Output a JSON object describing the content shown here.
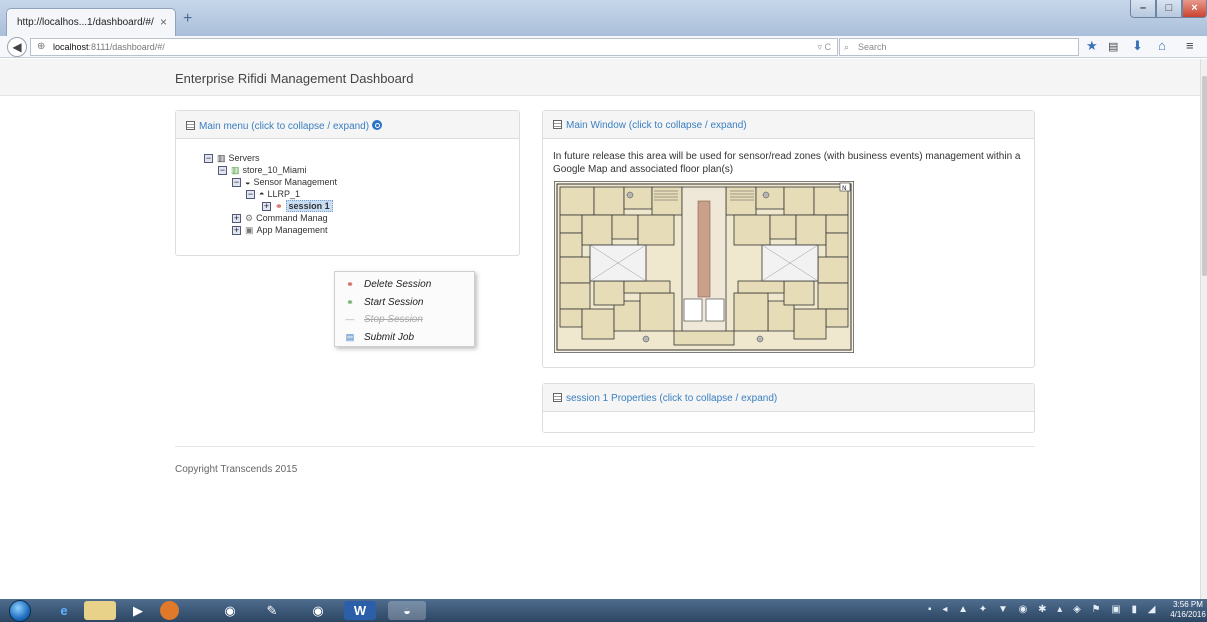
{
  "browser": {
    "tab_title": "http://localhos...1/dashboard/#/",
    "tab_close": "×",
    "new_tab": "+",
    "url_host": "localhost",
    "url_rest": ":8111/dashboard/#/",
    "url_tools": "▿ C",
    "search_placeholder": "Search",
    "window_controls": {
      "minimize": "–",
      "maximize": "□",
      "close": "×"
    }
  },
  "page": {
    "title": "Enterprise Rifidi Management Dashboard",
    "main_menu_heading": "Main menu (click to collapse / expand)",
    "main_window_heading": "Main Window (click to collapse / expand)",
    "main_window_text": "In future release this area will be used for sensor/read zones (with business events) management within a Google Map and associated floor plan(s)",
    "properties_heading": "session 1 Properties (click to collapse / expand)",
    "copyright": "Copyright Transcends 2015"
  },
  "tree": {
    "servers": "Servers",
    "store": "store_10_Miami",
    "sensor_management": "Sensor Management",
    "reader": "LLRP_1",
    "session": "session 1",
    "command_management": "Command Manag",
    "app_management": "App Management"
  },
  "context_menu": {
    "items": [
      {
        "label": "Delete Session",
        "icon": "delete-session-icon",
        "enabled": true
      },
      {
        "label": "Start Session",
        "icon": "start-session-icon",
        "enabled": true
      },
      {
        "label": "Stop Session",
        "icon": "stop-session-icon",
        "enabled": false
      },
      {
        "label": "Submit Job",
        "icon": "submit-job-icon",
        "enabled": true
      }
    ]
  },
  "taskbar": {
    "clock_time": "3:56 PM",
    "clock_date": "4/16/2016"
  },
  "colors": {
    "accent_link": "#3a7fc1",
    "panel_header_bg": "#f5f5f5",
    "selected_node_bg": "#c9def4"
  }
}
